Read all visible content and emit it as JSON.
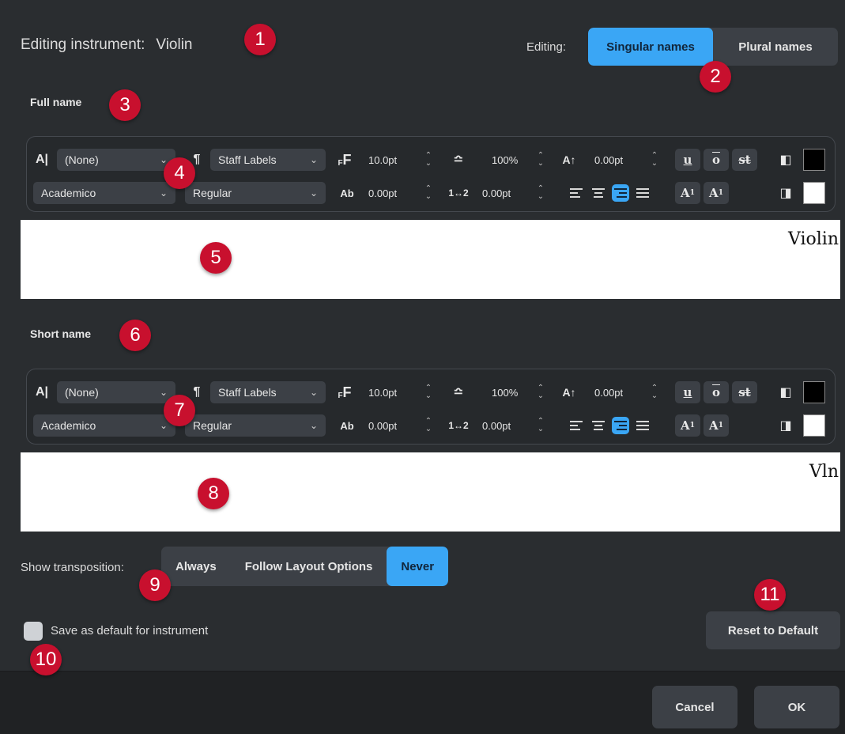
{
  "header": {
    "editing_instrument_label": "Editing instrument:",
    "instrument_name": "Violin",
    "editing_label": "Editing:",
    "name_modes": [
      {
        "label": "Singular names",
        "active": true
      },
      {
        "label": "Plural names",
        "active": false
      }
    ]
  },
  "full_name": {
    "section_title": "Full name",
    "toolbar": {
      "char_style": "(None)",
      "para_style": "Staff Labels",
      "font_size": "10.0pt",
      "scale": "100%",
      "baseline": "0.00pt",
      "font_family": "Academico",
      "font_style": "Regular",
      "char_spacing": "0.00pt",
      "line_spacing": "0.00pt",
      "alignment": "right",
      "foreground_color": "#000000",
      "background_color": "#ffffff"
    },
    "preview_text": "Violin"
  },
  "short_name": {
    "section_title": "Short name",
    "toolbar": {
      "char_style": "(None)",
      "para_style": "Staff Labels",
      "font_size": "10.0pt",
      "scale": "100%",
      "baseline": "0.00pt",
      "font_family": "Academico",
      "font_style": "Regular",
      "char_spacing": "0.00pt",
      "line_spacing": "0.00pt",
      "alignment": "right",
      "foreground_color": "#000000",
      "background_color": "#ffffff"
    },
    "preview_text": "Vln"
  },
  "transposition": {
    "label": "Show transposition:",
    "options": [
      {
        "label": "Always",
        "active": false
      },
      {
        "label": "Follow Layout Options",
        "active": false
      },
      {
        "label": "Never",
        "active": true
      }
    ]
  },
  "save_default": {
    "label": "Save as default for instrument",
    "checked": false
  },
  "buttons": {
    "reset": "Reset to Default",
    "cancel": "Cancel",
    "ok": "OK"
  },
  "toolbar_glyphs": {
    "underline": "u",
    "overline": "o",
    "strikethrough": "st",
    "superscript_base": "A",
    "superscript_mark": "1",
    "subscript_base": "A",
    "subscript_mark": "1"
  },
  "callouts": [
    "1",
    "2",
    "3",
    "4",
    "5",
    "6",
    "7",
    "8",
    "9",
    "10",
    "11"
  ],
  "colors": {
    "accent": "#3aa6f5",
    "background": "#2a2d30",
    "callout": "#c8102e"
  }
}
